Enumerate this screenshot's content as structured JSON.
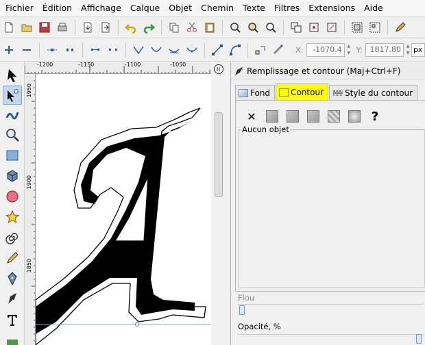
{
  "menu": [
    "Fichier",
    "Édition",
    "Affichage",
    "Calque",
    "Objet",
    "Chemin",
    "Texte",
    "Filtres",
    "Extensions",
    "Aide"
  ],
  "coords": {
    "x_label": "X:",
    "x_value": "-1070.4",
    "y_label": "Y:",
    "y_value": "1817.80",
    "unit": "px"
  },
  "ruler": {
    "top_labels": [
      "-1200",
      "-1150",
      "-1100",
      "-1050"
    ],
    "left_labels": [
      "1950",
      "1900",
      "1850"
    ]
  },
  "panel": {
    "title": "Remplissage et contour (Maj+Ctrl+F)",
    "tabs": [
      {
        "label": "Fond",
        "active": false
      },
      {
        "label": "Contour",
        "active": true
      },
      {
        "label": "Style du contour",
        "active": false
      }
    ],
    "paint_none_symbol": "✕",
    "paint_unknown_symbol": "?",
    "frame_label": "Aucun objet",
    "blur_label": "Flou",
    "opacity_label": "Opacité, %"
  },
  "colors": {
    "active_tab": "#ffff00",
    "canvas": "#ffffff",
    "glyph_fill": "#000000"
  }
}
